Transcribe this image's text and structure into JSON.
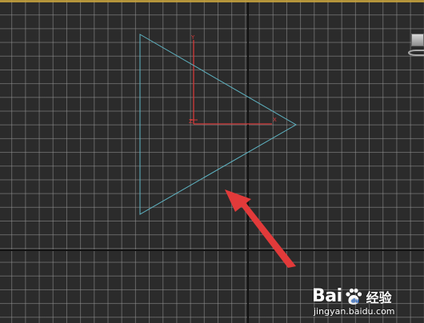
{
  "viewport": {
    "colors": {
      "background": "#2b2b2b",
      "grid": "#969696",
      "home_axis": "#111111",
      "frame_accent": "#c8a23a",
      "shape": "#5fb5c4",
      "gizmo": "#d33a3a",
      "arrow": "#e23a3a"
    }
  },
  "gizmo": {
    "y_label": "Y",
    "x_label": "X",
    "origin_label": "Z"
  },
  "viewcube": {
    "icon": "viewcube-icon"
  },
  "watermark": {
    "brand_a": "Bai",
    "brand_b": "u",
    "brand_cn": "经验",
    "url": "jingyan.baidu.com"
  }
}
